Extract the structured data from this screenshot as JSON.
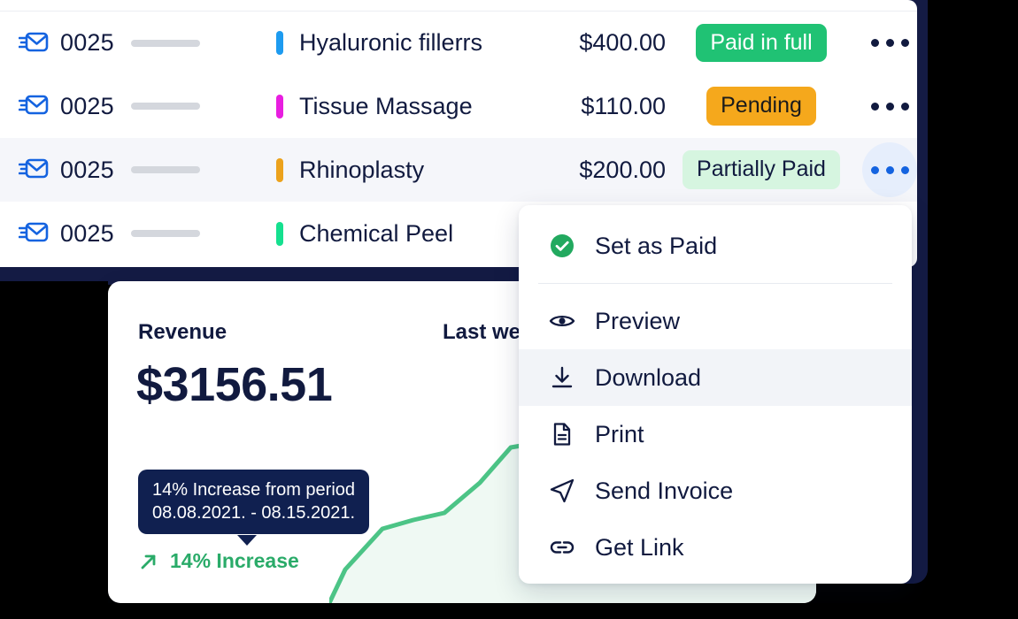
{
  "invoice_table": {
    "columns": [
      "icon",
      "invoice_number",
      "placeholder",
      "service",
      "amount",
      "status",
      "actions"
    ],
    "rows": [
      {
        "mail_icon": "send-mail-icon",
        "invoice_number": "0025",
        "service": "Hyaluronic fillerrs",
        "service_color": "#1d9bf0",
        "amount": "$400.00",
        "status": "Paid in full",
        "status_style": "paid",
        "selected": false
      },
      {
        "mail_icon": "send-mail-icon",
        "invoice_number": "0025",
        "service": "Tissue Massage",
        "service_color": "#e81ee0",
        "amount": "$110.00",
        "status": "Pending",
        "status_style": "pending",
        "selected": false
      },
      {
        "mail_icon": "send-mail-icon",
        "invoice_number": "0025",
        "service": "Rhinoplasty",
        "service_color": "#eca21c",
        "amount": "$200.00",
        "status": "Partially Paid",
        "status_style": "partial",
        "selected": true
      },
      {
        "mail_icon": "send-mail-icon",
        "invoice_number": "0025",
        "service": "Chemical Peel",
        "service_color": "#15e08f",
        "amount": "",
        "status": "",
        "status_style": "none",
        "selected": false
      }
    ]
  },
  "context_menu": {
    "items": [
      {
        "label": "Set as Paid",
        "icon": "check-circle-icon",
        "highlighted": false
      },
      {
        "label": "Preview",
        "icon": "eye-icon",
        "highlighted": false
      },
      {
        "label": "Download",
        "icon": "download-icon",
        "highlighted": true
      },
      {
        "label": "Print",
        "icon": "document-icon",
        "highlighted": false
      },
      {
        "label": "Send Invoice",
        "icon": "send-icon",
        "highlighted": false
      },
      {
        "label": "Get Link",
        "icon": "link-icon",
        "highlighted": false
      }
    ]
  },
  "revenue_card": {
    "title": "Revenue",
    "period_label": "Last we",
    "amount": "$3156.51",
    "tooltip_line1": "14% Increase from period",
    "tooltip_line2": "08.08.2021. - 08.15.2021.",
    "delta_label": "14% Increase",
    "delta_icon": "trend-up-arrow-icon",
    "accent_color": "#2aab69"
  },
  "chart_data": {
    "type": "area",
    "title": "Revenue",
    "series": [
      {
        "name": "Revenue",
        "values": [
          0,
          18,
          26,
          30,
          38,
          62,
          78,
          80,
          70,
          58,
          54,
          52,
          53
        ]
      }
    ],
    "x": [
      0,
      1,
      2,
      3,
      4,
      5,
      6,
      7,
      8,
      9,
      10,
      11,
      12
    ],
    "line_color": "#4cc486",
    "fill_color": "#eff9f3",
    "grid": false,
    "legend": "none",
    "xlabel": "",
    "ylabel": ""
  },
  "colors": {
    "backdrop_navy": "#141b44",
    "text_navy": "#111a3f",
    "accent_blue": "#1463e0",
    "green": "#20c274",
    "amber": "#f5a81c",
    "light_green": "#d6f5e0",
    "row_selected": "#f5f6fa"
  }
}
